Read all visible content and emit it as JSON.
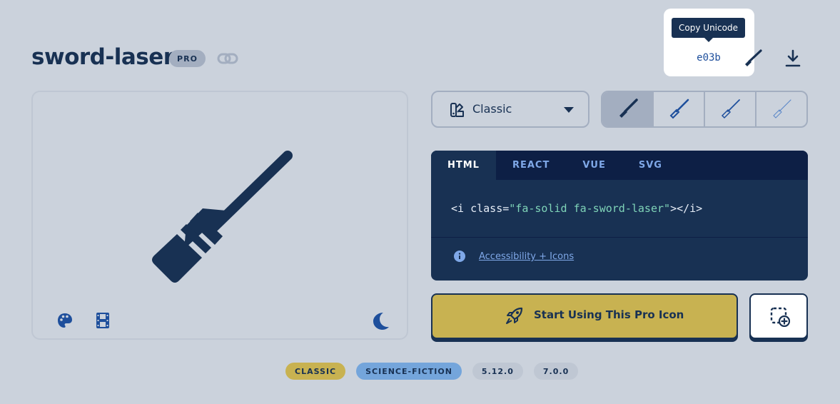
{
  "header": {
    "icon_name": "sword-laser",
    "badge": "PRO",
    "link_icon": "link-icon"
  },
  "tooltip": {
    "label": "Copy Unicode",
    "unicode": "e03b",
    "download_icon": "download-icon"
  },
  "preview": {
    "icon": "sword-laser-icon",
    "tools": [
      "palette-icon",
      "film-icon",
      "moon-icon"
    ]
  },
  "family_select": {
    "selected": "Classic"
  },
  "styles": [
    {
      "name": "solid",
      "active": true
    },
    {
      "name": "regular",
      "active": false
    },
    {
      "name": "light",
      "active": false
    },
    {
      "name": "thin",
      "active": false
    }
  ],
  "code": {
    "tabs": [
      {
        "label": "HTML",
        "active": true
      },
      {
        "label": "REACT",
        "active": false
      },
      {
        "label": "VUE",
        "active": false
      },
      {
        "label": "SVG",
        "active": false
      }
    ],
    "snippet": {
      "prefix": "<i class=",
      "value": "\"fa-solid fa-sword-laser\"",
      "suffix": "></i>"
    },
    "accessibility_link": "Accessibility + Icons"
  },
  "cta": {
    "label": "Start Using This Pro Icon"
  },
  "tags": [
    "CLASSIC",
    "SCIENCE-FICTION",
    "5.12.0",
    "7.0.0"
  ],
  "colors": {
    "background": "#cbd2dc",
    "navy": "#183153",
    "gold": "#c8b251",
    "blue": "#74a5db"
  }
}
